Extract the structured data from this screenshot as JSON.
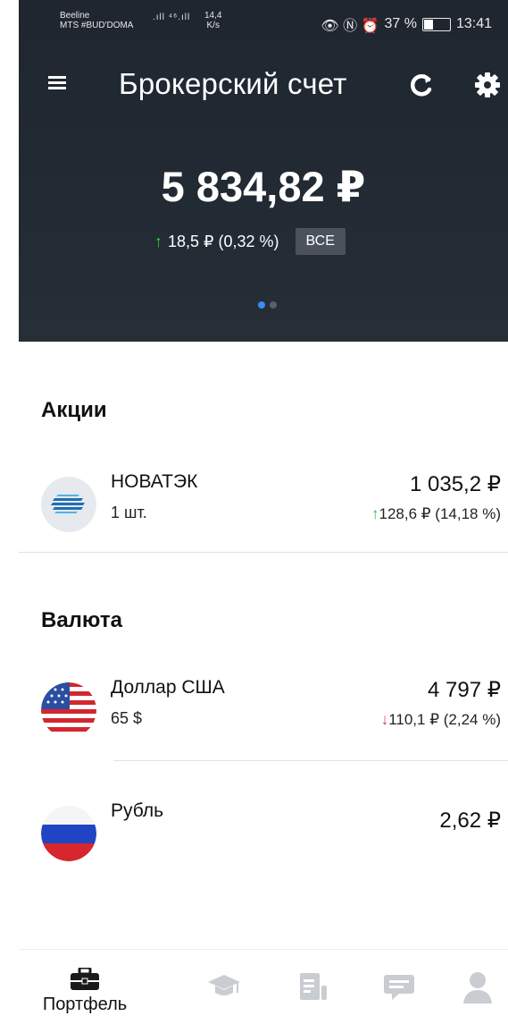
{
  "status_bar": {
    "carrier_line1": "Beeline",
    "carrier_line2": "MTS #BUD'DOMA",
    "signal": ".ıll ⁴⁶.ıll",
    "speed_value": "14,4",
    "speed_unit": "K/s",
    "icons_text": "👁 Ⓝ ⏰",
    "battery": "37 %",
    "battery_level": 0.37,
    "time": "13:41"
  },
  "header": {
    "title": "Брокерский счет",
    "balance": "5 834,82 ₽",
    "change_arrow": "↑",
    "change": "18,5 ₽ (0,32 %)",
    "filter_label": "ВСЕ",
    "pages_total": 2,
    "page_active": 1
  },
  "sections": {
    "stocks": {
      "title": "Акции",
      "items": [
        {
          "name": "НОВАТЭК",
          "qty": "1 шт.",
          "price": "1 035,2 ₽",
          "arrow": "↑",
          "delta": "128,6 ₽ (14,18 %)",
          "direction": "up"
        }
      ]
    },
    "currency": {
      "title": "Валюта",
      "items": [
        {
          "name": "Доллар США",
          "qty": "65 $",
          "price": "4 797 ₽",
          "arrow": "↓",
          "delta": "110,1 ₽ (2,24 %)",
          "direction": "down"
        },
        {
          "name": "Рубль",
          "qty": "",
          "price": "2,62 ₽",
          "arrow": "",
          "delta": "",
          "direction": "none"
        }
      ]
    }
  },
  "bottom_nav": {
    "items": [
      {
        "label": "Портфель",
        "icon": "briefcase-icon",
        "active": true
      },
      {
        "label": "",
        "icon": "graduation-cap-icon",
        "active": false
      },
      {
        "label": "",
        "icon": "news-icon",
        "active": false
      },
      {
        "label": "",
        "icon": "chat-icon",
        "active": false
      },
      {
        "label": "",
        "icon": "profile-icon",
        "active": false
      }
    ]
  },
  "colors": {
    "header_bg": "#222a34",
    "up": "#2fbf47",
    "down": "#e23a3a",
    "accent": "#3b8cf4"
  }
}
